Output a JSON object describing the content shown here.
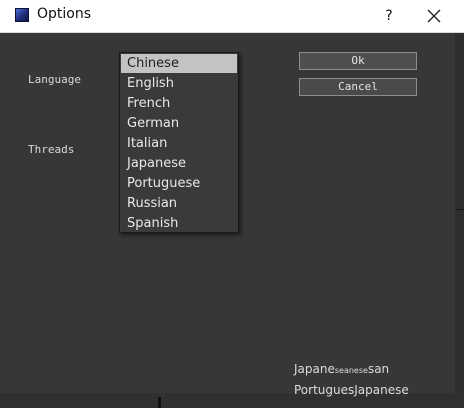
{
  "window": {
    "title": "Options",
    "help": "?"
  },
  "form": {
    "language_label": "Language",
    "threads_label": "Threads"
  },
  "buttons": {
    "ok": "Ok",
    "cancel": "Cancel"
  },
  "language_dropdown": {
    "selected": "Chinese",
    "options": [
      "Chinese",
      "English",
      "French",
      "German",
      "Italian",
      "Japanese",
      "Portuguese",
      "Russian",
      "Spanish"
    ]
  },
  "ghost_text": {
    "line1_a": "Japane",
    "line1_b": "se",
    "line1_c": "anese",
    "line1_d": "san",
    "line2_a": "Portugues",
    "line2_b": "Japanese"
  },
  "icons": {
    "app": "app-icon",
    "close": "close-icon"
  }
}
